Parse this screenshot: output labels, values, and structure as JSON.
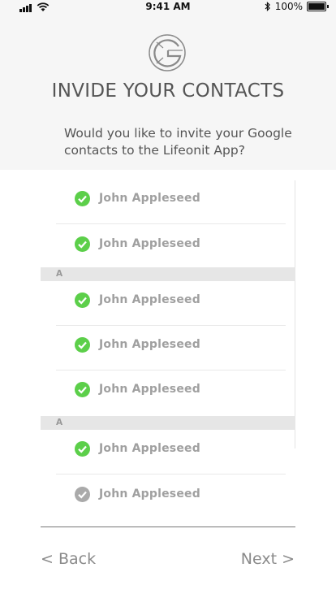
{
  "status_bar": {
    "time": "9:41 AM",
    "battery": "100%"
  },
  "header": {
    "logo_icon": "google-g-icon",
    "title": "INVIDE YOUR CONTACTS",
    "subtitle": "Would you like to invite your Google contacts to the Lifeonit App?"
  },
  "contacts": {
    "groups": [
      {
        "letter": "",
        "items": [
          {
            "name": "John Appleseed",
            "selected": true
          },
          {
            "name": "John Appleseed",
            "selected": true
          }
        ]
      },
      {
        "letter": "A",
        "items": [
          {
            "name": "John Appleseed",
            "selected": true
          },
          {
            "name": "John Appleseed",
            "selected": true
          },
          {
            "name": "John Appleseed",
            "selected": true
          }
        ]
      },
      {
        "letter": "A",
        "items": [
          {
            "name": "John Appleseed",
            "selected": true
          },
          {
            "name": "John Appleseed",
            "selected": false
          }
        ]
      }
    ]
  },
  "nav": {
    "back": "< Back",
    "next": "Next >"
  },
  "colors": {
    "check_selected": "#5ccf4a",
    "check_unselected": "#aaaaaa",
    "header_bg": "#f6f6f6"
  }
}
